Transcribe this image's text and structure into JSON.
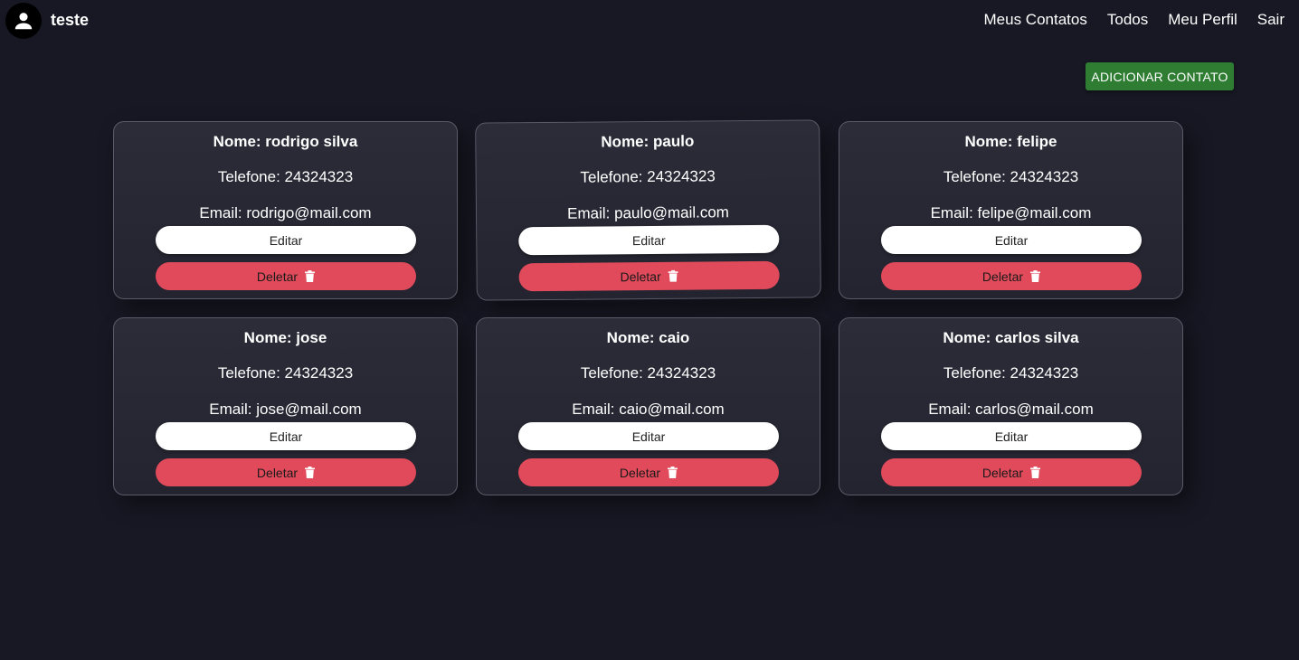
{
  "header": {
    "avatar_icon": "user-icon",
    "username": "teste",
    "nav": [
      {
        "label": "Meus Contatos"
      },
      {
        "label": "Todos"
      },
      {
        "label": "Meu Perfil"
      },
      {
        "label": "Sair"
      }
    ]
  },
  "add_button": {
    "label": "ADICIONAR CONTATO",
    "color": "#2e7d32"
  },
  "colors": {
    "background": "#181824",
    "card": "#2a2a36",
    "delete": "#e14a5a"
  },
  "contacts": [
    {
      "name": "Nome: rodrigo silva",
      "phone": "Telefone: 24324323",
      "email": "Email: rodrigo@mail.com",
      "edit_label": "Editar",
      "delete_label": "Deletar",
      "delete_icon": "trash-icon"
    },
    {
      "name": "Nome: paulo",
      "phone": "Telefone: 24324323",
      "email": "Email: paulo@mail.com",
      "edit_label": "Editar",
      "delete_label": "Deletar",
      "delete_icon": "trash-icon"
    },
    {
      "name": "Nome: felipe",
      "phone": "Telefone: 24324323",
      "email": "Email: felipe@mail.com",
      "edit_label": "Editar",
      "delete_label": "Deletar",
      "delete_icon": "trash-icon"
    },
    {
      "name": "Nome: jose",
      "phone": "Telefone: 24324323",
      "email": "Email: jose@mail.com",
      "edit_label": "Editar",
      "delete_label": "Deletar",
      "delete_icon": "trash-icon"
    },
    {
      "name": "Nome: caio",
      "phone": "Telefone: 24324323",
      "email": "Email: caio@mail.com",
      "edit_label": "Editar",
      "delete_label": "Deletar",
      "delete_icon": "trash-icon"
    },
    {
      "name": "Nome: carlos silva",
      "phone": "Telefone: 24324323",
      "email": "Email: carlos@mail.com",
      "edit_label": "Editar",
      "delete_label": "Deletar",
      "delete_icon": "trash-icon"
    }
  ]
}
